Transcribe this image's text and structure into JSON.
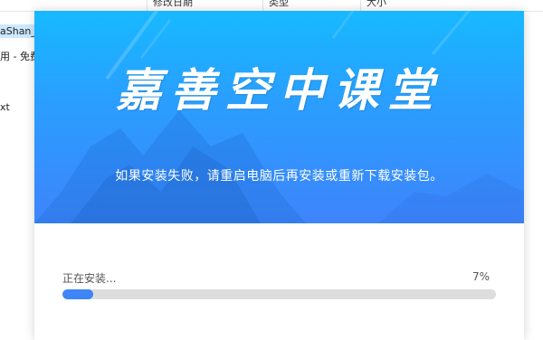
{
  "explorer": {
    "columns": [
      "修改日期",
      "类型",
      "大小"
    ],
    "files": [
      "aShan_A",
      "用 - 免费",
      "xt"
    ]
  },
  "installer": {
    "logo_text": "嘉善空中课堂",
    "hint_text": "如果安装失败，请重启电脑后再安装或重新下载安装包。",
    "status_label": "正在安装...",
    "percent_text": "7%",
    "progress": 0.07,
    "colors": {
      "accent": "#3e86f8",
      "banner_top": "#17b9ff",
      "banner_bottom": "#3e84fb",
      "track": "#dddddd"
    }
  }
}
